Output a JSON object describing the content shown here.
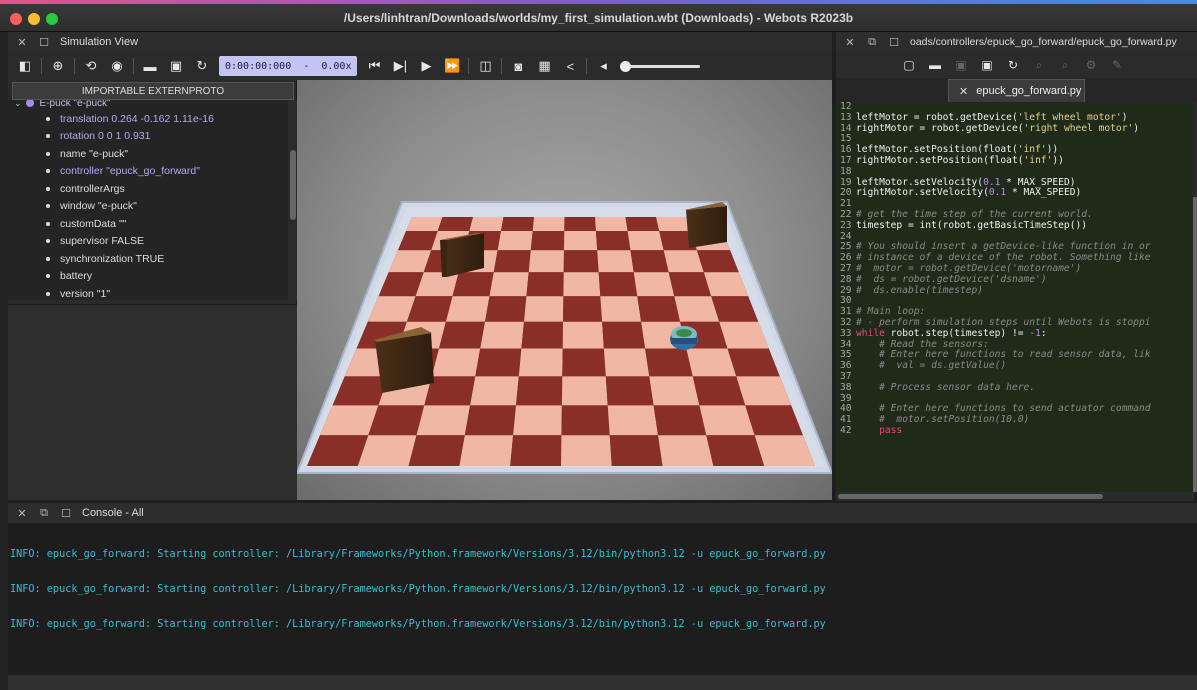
{
  "window": {
    "title": "/Users/linhtran/Downloads/worlds/my_first_simulation.wbt (Downloads) - Webots R2023b"
  },
  "sim_panel": {
    "title": "Simulation View",
    "clock": "0:00:00:000",
    "speed": "0.00x",
    "clock_sep": "-",
    "proto_button": "IMPORTABLE EXTERNPROTO"
  },
  "scene_tree": {
    "root": "E-puck \"e-puck\"",
    "items": [
      {
        "label": "translation 0.264 -0.162 1.11e-16"
      },
      {
        "label": "rotation 0 0 1 0.931"
      },
      {
        "label": "name \"e-puck\""
      },
      {
        "label": "controller \"epuck_go_forward\""
      },
      {
        "label": "controllerArgs"
      },
      {
        "label": "window \"e-puck\""
      },
      {
        "label": "customData \"\""
      },
      {
        "label": "supervisor FALSE"
      },
      {
        "label": "synchronization TRUE"
      },
      {
        "label": "battery"
      },
      {
        "label": "version \"1\""
      }
    ]
  },
  "editor": {
    "header_path": "oads/controllers/epuck_go_forward/epuck_go_forward.py",
    "tab_label": "epuck_go_forward.py",
    "lines": [
      {
        "n": "12",
        "t": ""
      },
      {
        "n": "13",
        "t": "leftMotor = robot.getDevice('left wheel motor')"
      },
      {
        "n": "14",
        "t": "rightMotor = robot.getDevice('right wheel motor')"
      },
      {
        "n": "15",
        "t": ""
      },
      {
        "n": "16",
        "t": "leftMotor.setPosition(float('inf'))"
      },
      {
        "n": "17",
        "t": "rightMotor.setPosition(float('inf'))"
      },
      {
        "n": "18",
        "t": ""
      },
      {
        "n": "19",
        "t": "leftMotor.setVelocity(0.1 * MAX_SPEED)"
      },
      {
        "n": "20",
        "t": "rightMotor.setVelocity(0.1 * MAX_SPEED)"
      },
      {
        "n": "21",
        "t": ""
      },
      {
        "n": "22",
        "t": "# get the time step of the current world."
      },
      {
        "n": "23",
        "t": "timestep = int(robot.getBasicTimeStep())"
      },
      {
        "n": "24",
        "t": ""
      },
      {
        "n": "25",
        "t": "# You should insert a getDevice-like function in or"
      },
      {
        "n": "26",
        "t": "# instance of a device of the robot. Something like"
      },
      {
        "n": "27",
        "t": "#  motor = robot.getDevice('motorname')"
      },
      {
        "n": "28",
        "t": "#  ds = robot.getDevice('dsname')"
      },
      {
        "n": "29",
        "t": "#  ds.enable(timestep)"
      },
      {
        "n": "30",
        "t": ""
      },
      {
        "n": "31",
        "t": "# Main loop:"
      },
      {
        "n": "32",
        "t": "# - perform simulation steps until Webots is stoppi"
      },
      {
        "n": "33",
        "t": "while robot.step(timestep) != -1:"
      },
      {
        "n": "34",
        "t": "    # Read the sensors:"
      },
      {
        "n": "35",
        "t": "    # Enter here functions to read sensor data, lik"
      },
      {
        "n": "36",
        "t": "    #  val = ds.getValue()"
      },
      {
        "n": "37",
        "t": ""
      },
      {
        "n": "38",
        "t": "    # Process sensor data here."
      },
      {
        "n": "39",
        "t": ""
      },
      {
        "n": "40",
        "t": "    # Enter here functions to send actuator command"
      },
      {
        "n": "41",
        "t": "    #  motor.setPosition(10.0)"
      },
      {
        "n": "42",
        "t": "    pass"
      }
    ]
  },
  "console": {
    "title": "Console - All",
    "lines": [
      "INFO: epuck_go_forward: Starting controller: /Library/Frameworks/Python.framework/Versions/3.12/bin/python3.12 -u epuck_go_forward.py",
      "INFO: epuck_go_forward: Starting controller: /Library/Frameworks/Python.framework/Versions/3.12/bin/python3.12 -u epuck_go_forward.py",
      "INFO: epuck_go_forward: Starting controller: /Library/Frameworks/Python.framework/Versions/3.12/bin/python3.12 -u epuck_go_forward.py"
    ]
  },
  "colors": {
    "clock_bg": "#c4c4f0",
    "console_text": "#35c0d4",
    "code_bg": "#1f2a19",
    "keyword": "#f0427d"
  }
}
